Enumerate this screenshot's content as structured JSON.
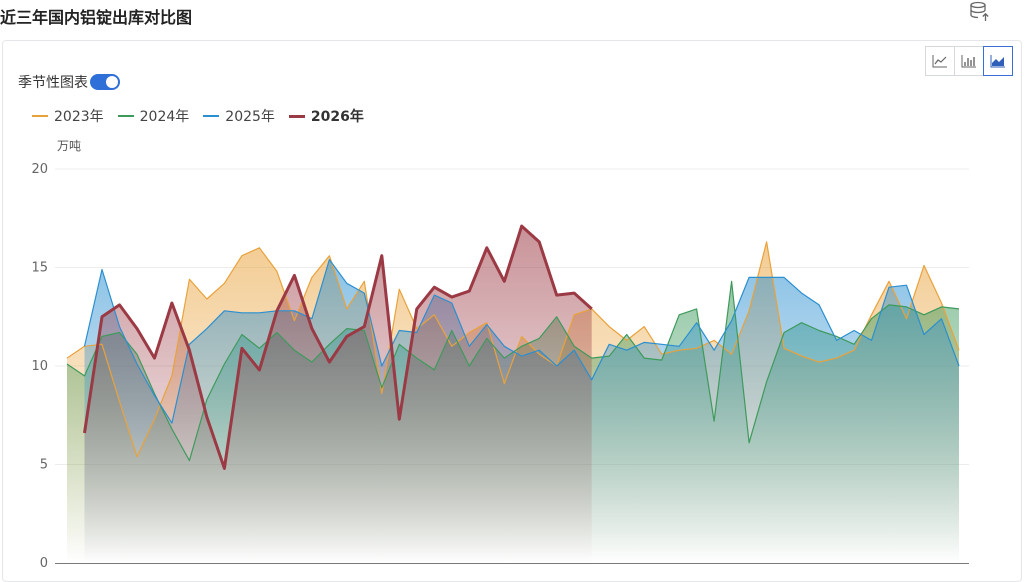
{
  "title": "近三年国内铝锭出库对比图",
  "seasonal_label": "季节性图表",
  "seasonal_on": true,
  "chart_types": [
    "line-chart-icon",
    "bar-chart-icon",
    "area-chart-icon"
  ],
  "active_chart_type": "area-chart-icon",
  "chart_data": {
    "type": "area",
    "ylabel": "万吨",
    "ylim": [
      0,
      20
    ],
    "yticks": [
      0,
      5,
      10,
      15,
      20
    ],
    "grid": true,
    "legend": "top-left",
    "x_count": 52,
    "series": [
      {
        "name": "2023年",
        "color": "#e9a23b",
        "values": [
          10.4,
          11.0,
          11.1,
          8.2,
          5.4,
          7.3,
          9.5,
          14.4,
          13.4,
          14.2,
          15.6,
          16.0,
          14.8,
          12.3,
          14.5,
          15.6,
          12.9,
          14.3,
          8.6,
          13.9,
          11.9,
          12.6,
          11.0,
          11.7,
          12.2,
          9.1,
          11.5,
          10.6,
          10.0,
          12.6,
          12.9,
          12.0,
          11.3,
          12.0,
          10.6,
          10.8,
          10.9,
          11.3,
          10.6,
          12.8,
          16.3,
          10.9,
          10.5,
          10.2,
          10.4,
          10.8,
          12.6,
          14.3,
          12.4,
          15.1,
          13.2,
          10.8
        ]
      },
      {
        "name": "2024年",
        "color": "#3e9a5c",
        "values": [
          10.1,
          9.5,
          11.5,
          11.7,
          10.6,
          8.6,
          6.8,
          5.2,
          8.3,
          10.1,
          11.6,
          10.9,
          11.7,
          10.8,
          10.2,
          11.1,
          11.9,
          11.8,
          8.9,
          11.1,
          10.4,
          9.8,
          11.8,
          10.0,
          11.4,
          10.4,
          11.0,
          11.4,
          12.5,
          11.0,
          10.4,
          10.5,
          11.6,
          10.4,
          10.3,
          12.6,
          12.9,
          7.2,
          14.3,
          6.1,
          9.2,
          11.7,
          12.2,
          11.8,
          11.5,
          11.1,
          12.4,
          13.1,
          13.0,
          12.6,
          13.0,
          12.9
        ]
      },
      {
        "name": "2025年",
        "color": "#2b8fd0",
        "values": [
          null,
          11.0,
          14.9,
          12.0,
          10.1,
          8.5,
          7.1,
          11.1,
          11.9,
          12.8,
          12.7,
          12.7,
          12.8,
          12.8,
          12.4,
          15.4,
          14.2,
          13.7,
          10.0,
          11.8,
          11.7,
          13.6,
          13.2,
          11.0,
          12.1,
          11.0,
          10.5,
          10.8,
          10.0,
          10.8,
          9.3,
          11.1,
          10.8,
          11.2,
          11.1,
          11.0,
          12.2,
          10.8,
          12.3,
          14.5,
          14.5,
          14.5,
          13.7,
          13.1,
          11.3,
          11.8,
          11.3,
          14.0,
          14.1,
          11.6,
          12.4,
          10.0
        ]
      },
      {
        "name": "2026年",
        "color": "#9b3a44",
        "bold": true,
        "values": [
          null,
          6.6,
          12.5,
          13.1,
          11.9,
          10.4,
          13.2,
          10.8,
          7.4,
          4.8,
          10.9,
          9.8,
          12.8,
          14.6,
          11.9,
          10.2,
          11.5,
          12.0,
          15.6,
          7.3,
          12.9,
          14.0,
          13.5,
          13.8,
          16.0,
          14.3,
          17.1,
          16.3,
          13.6,
          13.7,
          12.9,
          null,
          null,
          null,
          null,
          null,
          null,
          null,
          null,
          null,
          null,
          null,
          null,
          null,
          null,
          null,
          null,
          null,
          null,
          null,
          null,
          null
        ]
      }
    ]
  }
}
